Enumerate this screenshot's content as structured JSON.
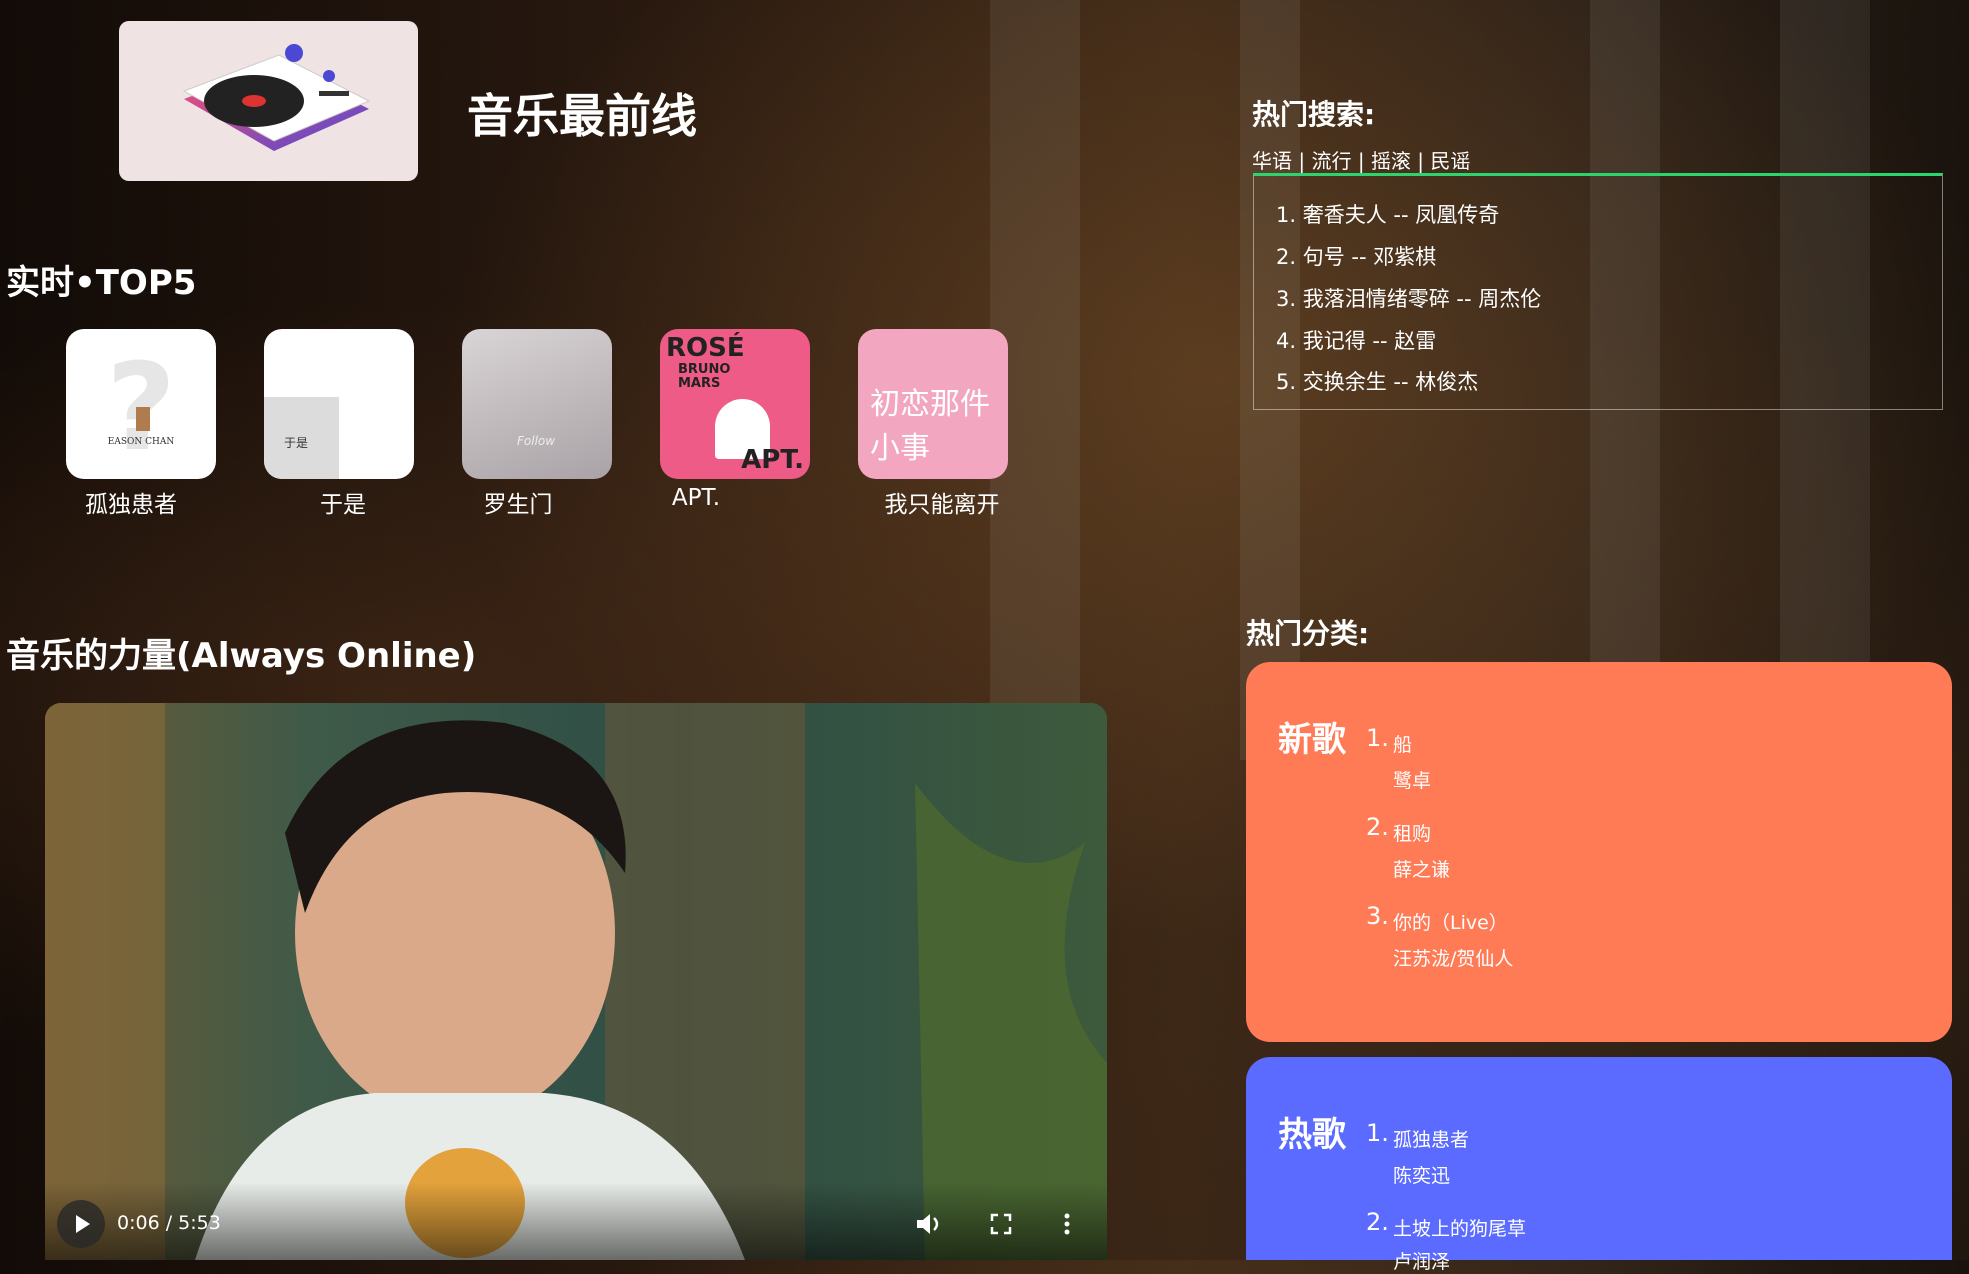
{
  "site": {
    "title": "音乐最前线"
  },
  "top5": {
    "title": "实时•TOP5",
    "albums": [
      {
        "name": "孤独患者",
        "cover_text": "EASON CHAN"
      },
      {
        "name": "于是",
        "cover_text": "于是"
      },
      {
        "name": "罗生门",
        "cover_text": "Follow"
      },
      {
        "name": "APT.",
        "cover_text": "ROSÉ BRUNO MARS APT."
      },
      {
        "name": "我只能离开",
        "cover_text": "初恋那件小事"
      }
    ]
  },
  "video_section": {
    "title": "音乐的力量(Always Online)",
    "player": {
      "time": "0:06 / 5:53"
    }
  },
  "hot_search": {
    "title": "热门搜索:",
    "tags": [
      "华语",
      "流行",
      "摇滚",
      "民谣"
    ],
    "separator": "|",
    "items": [
      "1. 奢香夫人 -- 凤凰传奇",
      "2. 句号 -- 邓紫棋",
      "3. 我落泪情绪零碎 -- 周杰伦",
      "4. 我记得 -- 赵雷",
      "5. 交换余生 -- 林俊杰"
    ]
  },
  "categories": {
    "title": "热门分类:",
    "cards": [
      {
        "name": "新歌",
        "color": "#ff7b56",
        "songs": [
          {
            "num": "1.",
            "title": "船",
            "artist": "鹭卓"
          },
          {
            "num": "2.",
            "title": "租购",
            "artist": "薛之谦"
          },
          {
            "num": "3.",
            "title": "你的（Live）",
            "artist": "汪苏泷/贺仙人"
          }
        ]
      },
      {
        "name": "热歌",
        "color": "#5b6bff",
        "songs": [
          {
            "num": "1.",
            "title": "孤独患者",
            "artist": "陈奕迅"
          },
          {
            "num": "2.",
            "title": "土坡上的狗尾草",
            "artist": "卢润泽"
          }
        ]
      }
    ]
  }
}
